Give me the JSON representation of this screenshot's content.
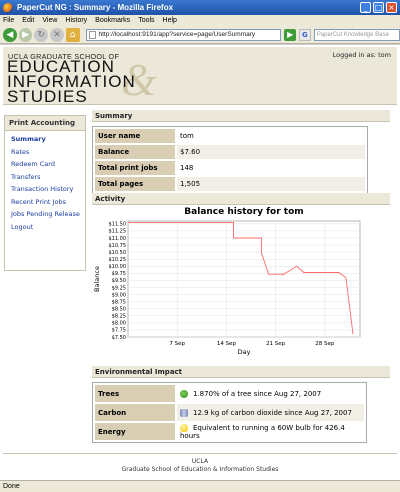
{
  "window": {
    "title": "PaperCut NG : Summary - Mozilla Firefox"
  },
  "menu": [
    "File",
    "Edit",
    "View",
    "History",
    "Bookmarks",
    "Tools",
    "Help"
  ],
  "browser": {
    "url": "http://localhost:9191/app?service=page/UserSummary",
    "search_placeholder": "PaperCut Knowledge Base"
  },
  "header": {
    "school_line": "UCLA GRADUATE SCHOOL OF",
    "line1": "EDUCATION",
    "line2": "INFORMATION",
    "line3": "STUDIES",
    "amp": "&",
    "login": "Logged in as:  tom"
  },
  "sidebar": {
    "heading": "Print Accounting",
    "items": [
      {
        "label": "Summary"
      },
      {
        "label": "Rates"
      },
      {
        "label": "Redeem Card"
      },
      {
        "label": "Transfers"
      },
      {
        "label": "Transaction History"
      },
      {
        "label": "Recent Print Jobs"
      },
      {
        "label": "Jobs Pending Release"
      },
      {
        "label": "Logout"
      }
    ]
  },
  "summary": {
    "heading": "Summary",
    "rows": [
      {
        "label": "User name",
        "value": "tom"
      },
      {
        "label": "Balance",
        "value": "$7.60"
      },
      {
        "label": "Total print jobs",
        "value": "148"
      },
      {
        "label": "Total pages",
        "value": "1,505"
      }
    ]
  },
  "activity": {
    "heading": "Activity"
  },
  "chart_data": {
    "type": "line",
    "title": "Balance history for tom",
    "xlabel": "Day",
    "ylabel": "Balance",
    "x_ticks": [
      "7 Sep",
      "14 Sep",
      "21 Sep",
      "28 Sep"
    ],
    "y_ticks": [
      "$7.50",
      "$7.75",
      "$8.00",
      "$8.25",
      "$8.50",
      "$8.75",
      "$9.00",
      "$9.25",
      "$9.50",
      "$9.75",
      "$10.00",
      "$10.25",
      "$10.50",
      "$10.75",
      "$11.00",
      "$11.25",
      "$11.50"
    ],
    "ylim": [
      7.5,
      11.6
    ],
    "xlim": [
      "2007-08-31",
      "2007-10-03"
    ],
    "grid": true,
    "color": "#ff6a6a",
    "series": [
      {
        "x": [
          "2007-08-31",
          "2007-09-15",
          "2007-09-15",
          "2007-09-19",
          "2007-09-19",
          "2007-09-20",
          "2007-09-22",
          "2007-09-22",
          "2007-09-24",
          "2007-09-25",
          "2007-09-27",
          "2007-09-30",
          "2007-10-01",
          "2007-10-02"
        ],
        "y": [
          11.55,
          11.55,
          11.0,
          11.0,
          10.45,
          9.72,
          9.72,
          9.7,
          10.0,
          9.78,
          9.78,
          9.78,
          9.6,
          7.6
        ]
      }
    ]
  },
  "environment": {
    "heading": "Environmental Impact",
    "rows": [
      {
        "label": "Trees",
        "icon": "tree-icon",
        "value": "1.870% of a tree since Aug 27, 2007"
      },
      {
        "label": "Carbon",
        "icon": "carbon-icon",
        "value": "12.9 kg of carbon dioxide since Aug 27, 2007"
      },
      {
        "label": "Energy",
        "icon": "bulb-icon",
        "value": "Equivalent to running a 60W bulb for 426.4 hours"
      }
    ]
  },
  "footer": {
    "line1": "UCLA",
    "line2": "Graduate School of Education & Information Studies"
  },
  "status": "Done"
}
